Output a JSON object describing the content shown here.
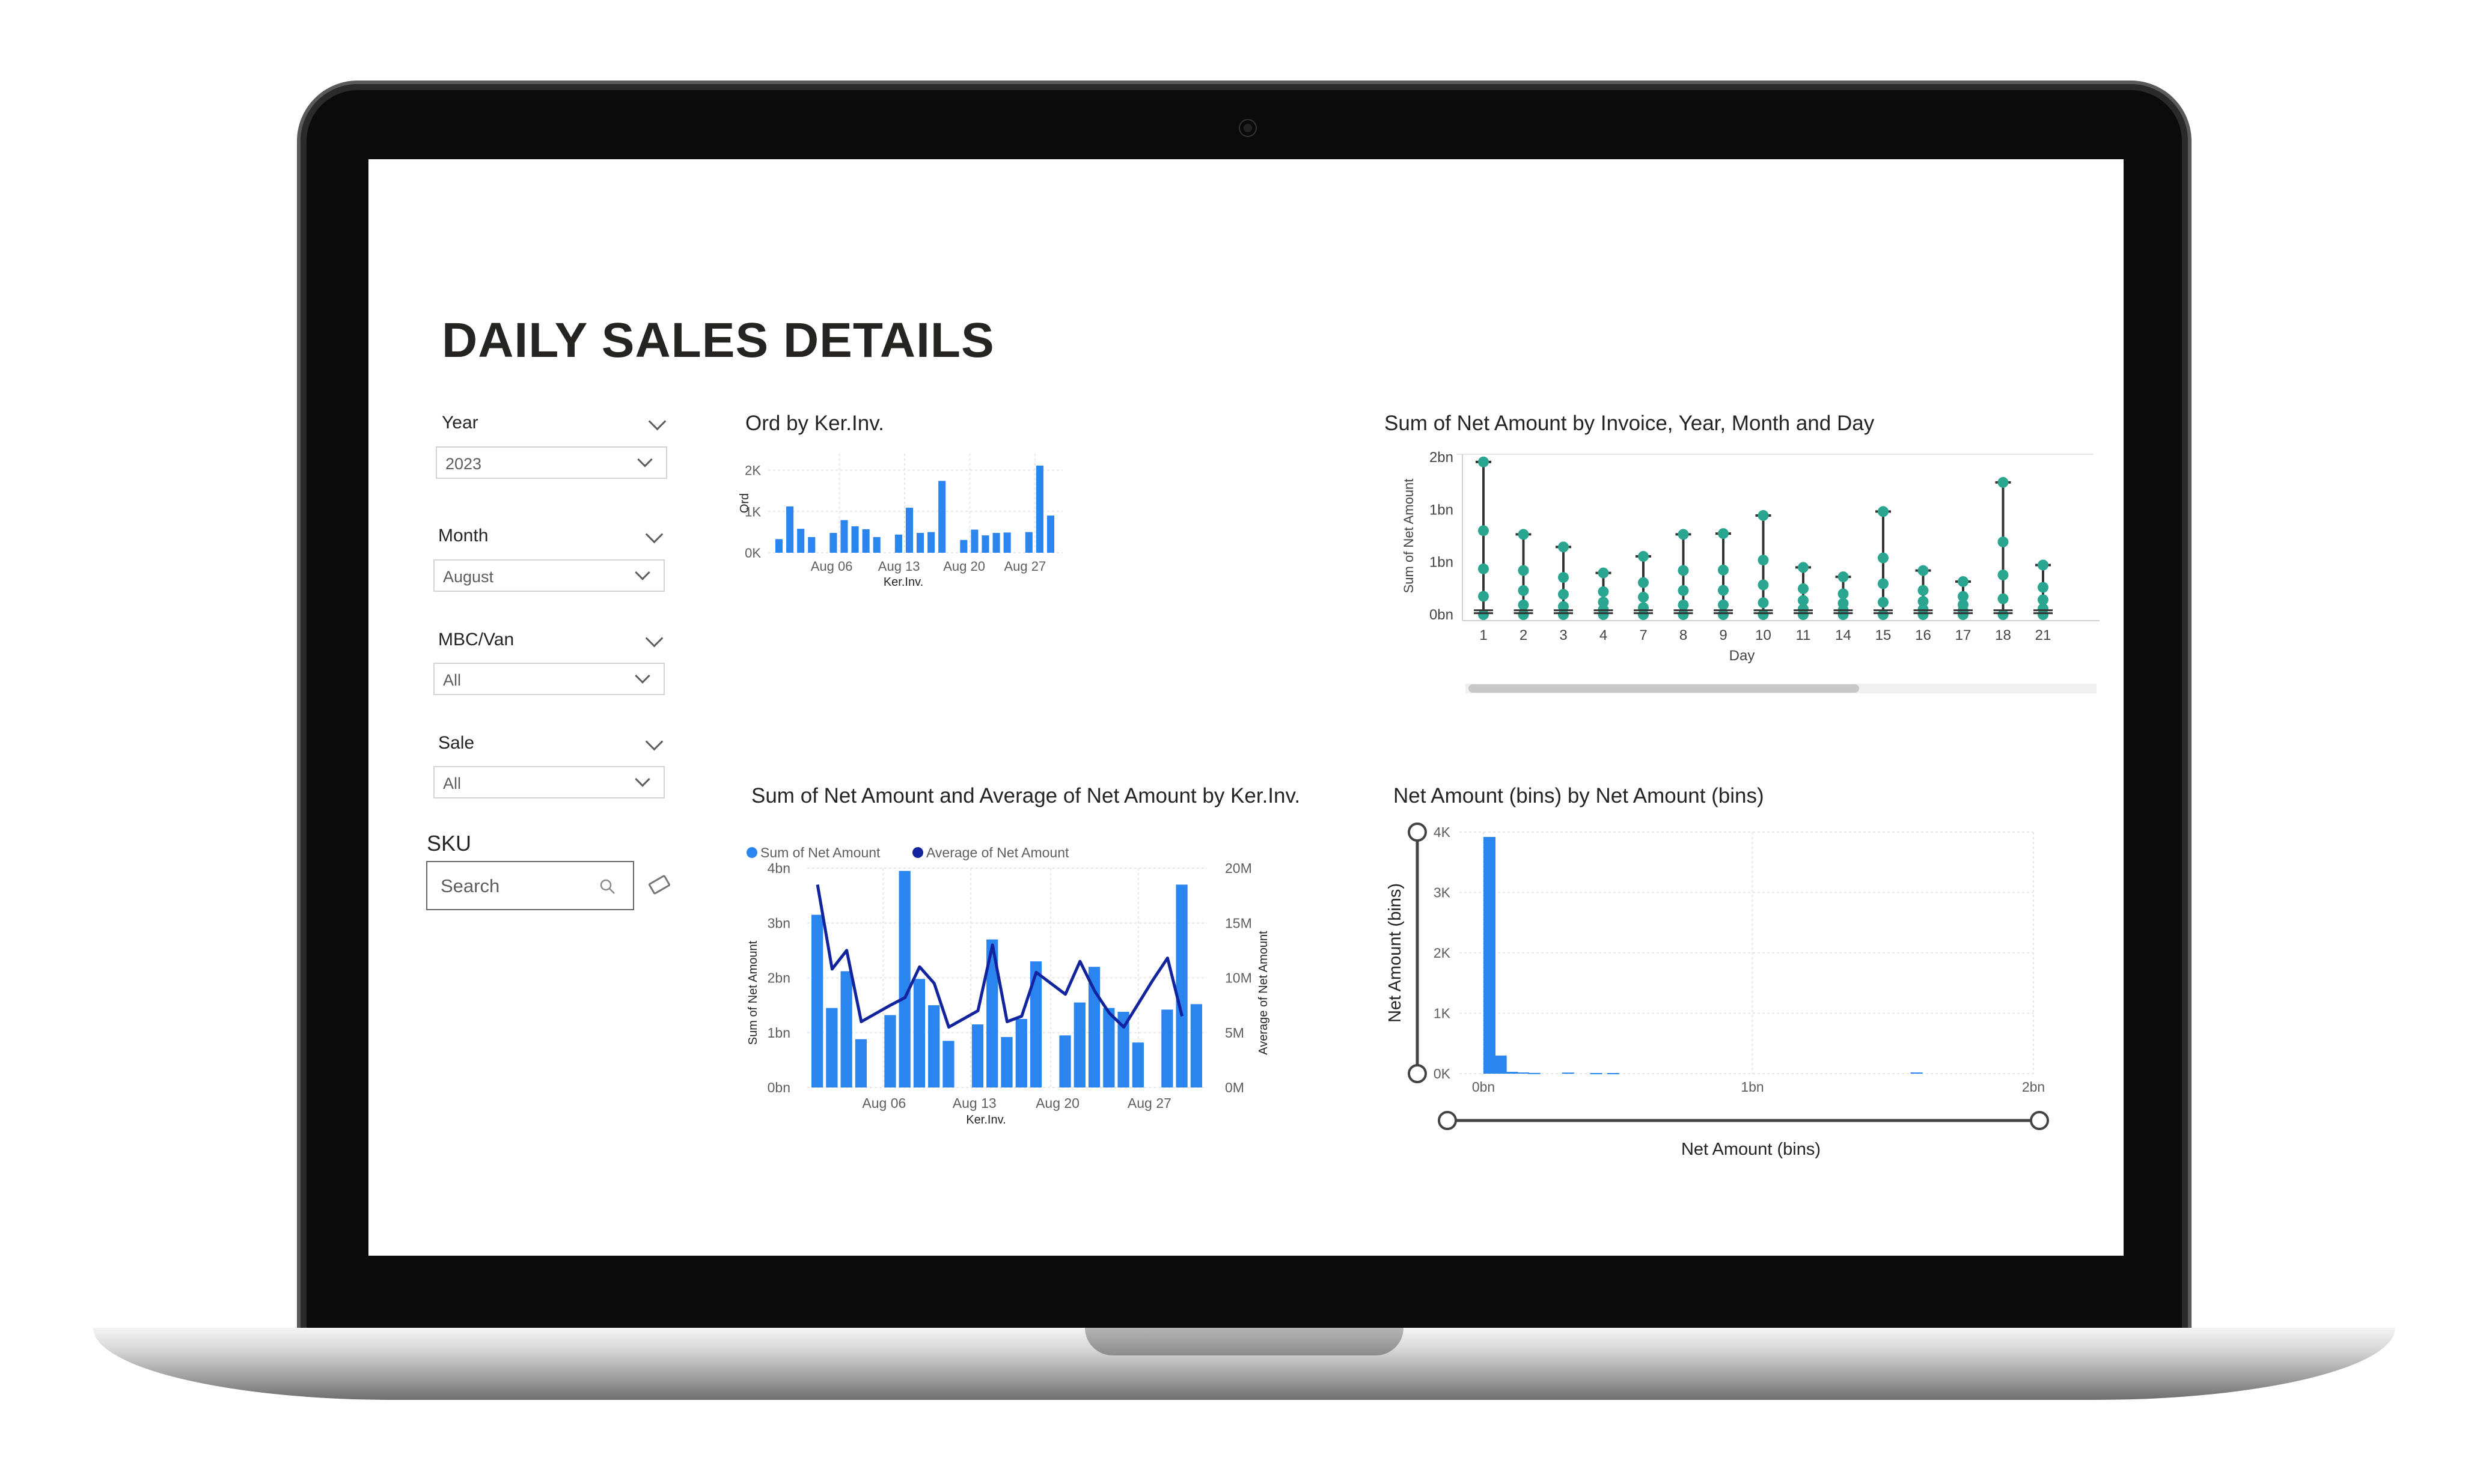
{
  "report": {
    "title": "DAILY SALES DETAILS"
  },
  "slicers": [
    {
      "label": "Year",
      "value": "2023"
    },
    {
      "label": "Month",
      "value": "August"
    },
    {
      "label": "MBC/Van",
      "value": "All"
    },
    {
      "label": "Sale",
      "value": "All"
    }
  ],
  "sku": {
    "label": "SKU",
    "placeholder": "Search"
  },
  "colors": {
    "bar": "#2b85ee",
    "line": "#12239e",
    "teal": "#2aa58f",
    "stem": "#333333"
  },
  "chart_data": [
    {
      "type": "bar",
      "title": "Ord by Ker.Inv.",
      "xlabel": "Ker.Inv.",
      "ylabel": "Ord",
      "ylim": [
        0,
        2400
      ],
      "y_ticks": [
        "0K",
        "1K",
        "2K"
      ],
      "x_ticks": [
        "Aug 06",
        "Aug 13",
        "Aug 20",
        "Aug 27"
      ],
      "values": [
        330,
        1120,
        580,
        380,
        null,
        480,
        790,
        640,
        570,
        380,
        null,
        440,
        1090,
        480,
        500,
        1740,
        null,
        310,
        560,
        420,
        480,
        490,
        null,
        500,
        2110,
        900
      ]
    },
    {
      "type": "scatter",
      "title": "Sum of Net Amount by Invoice, Year, Month and Day",
      "xlabel": "Day",
      "ylabel": "Sum of Net Amount",
      "y_ticks": [
        "0bn",
        "1bn",
        "1bn",
        "2bn"
      ],
      "categories": [
        "1",
        "2",
        "3",
        "4",
        "7",
        "8",
        "9",
        "10",
        "11",
        "14",
        "15",
        "16",
        "17",
        "18",
        "21"
      ],
      "max_values": [
        1.94,
        1.02,
        0.86,
        0.53,
        0.74,
        1.02,
        1.03,
        1.26,
        0.6,
        0.48,
        1.31,
        0.56,
        0.42,
        1.68,
        0.63
      ]
    },
    {
      "type": "bar",
      "title": "Sum of Net Amount and Average of Net Amount by Ker.Inv.",
      "xlabel": "Ker.Inv.",
      "ylabel": "Sum of Net Amount",
      "y2label": "Average of Net Amount",
      "legend": [
        "Sum of Net Amount",
        "Average of Net Amount"
      ],
      "y_ticks": [
        "0bn",
        "1bn",
        "2bn",
        "3bn",
        "4bn"
      ],
      "y2_ticks": [
        "0M",
        "5M",
        "10M",
        "15M",
        "20M"
      ],
      "x_ticks": [
        "Aug 06",
        "Aug 13",
        "Aug 20",
        "Aug 27"
      ],
      "series": [
        {
          "name": "Sum of Net Amount",
          "values": [
            3.15,
            1.45,
            2.12,
            0.88,
            null,
            1.32,
            3.95,
            1.98,
            1.5,
            0.85,
            null,
            1.15,
            2.7,
            0.92,
            1.25,
            2.3,
            null,
            0.95,
            1.55,
            2.2,
            1.45,
            1.38,
            0.82,
            null,
            1.42,
            3.7,
            1.52
          ]
        },
        {
          "name": "Average of Net Amount",
          "values": [
            18.5,
            10.8,
            12.5,
            6.0,
            null,
            7.5,
            8.2,
            11.0,
            9.5,
            5.5,
            null,
            7.0,
            13.0,
            6.0,
            6.5,
            10.5,
            null,
            8.5,
            11.5,
            8.8,
            6.8,
            5.5,
            null,
            9.8,
            11.8,
            6.5
          ]
        }
      ]
    },
    {
      "type": "bar",
      "title": "Net Amount (bins) by Net Amount (bins)",
      "xlabel": "Net Amount (bins)",
      "ylabel": "Net Amount (bins)",
      "ylim": [
        0,
        4000
      ],
      "y_ticks": [
        "0K",
        "1K",
        "2K",
        "3K",
        "4K"
      ],
      "x_ticks": [
        "0bn",
        "1bn",
        "2bn"
      ],
      "x": [
        0.0,
        0.04,
        0.08,
        0.12,
        0.16,
        0.28,
        0.38,
        0.44,
        1.52
      ],
      "values": [
        3920,
        300,
        30,
        20,
        12,
        18,
        10,
        10,
        20
      ]
    }
  ]
}
